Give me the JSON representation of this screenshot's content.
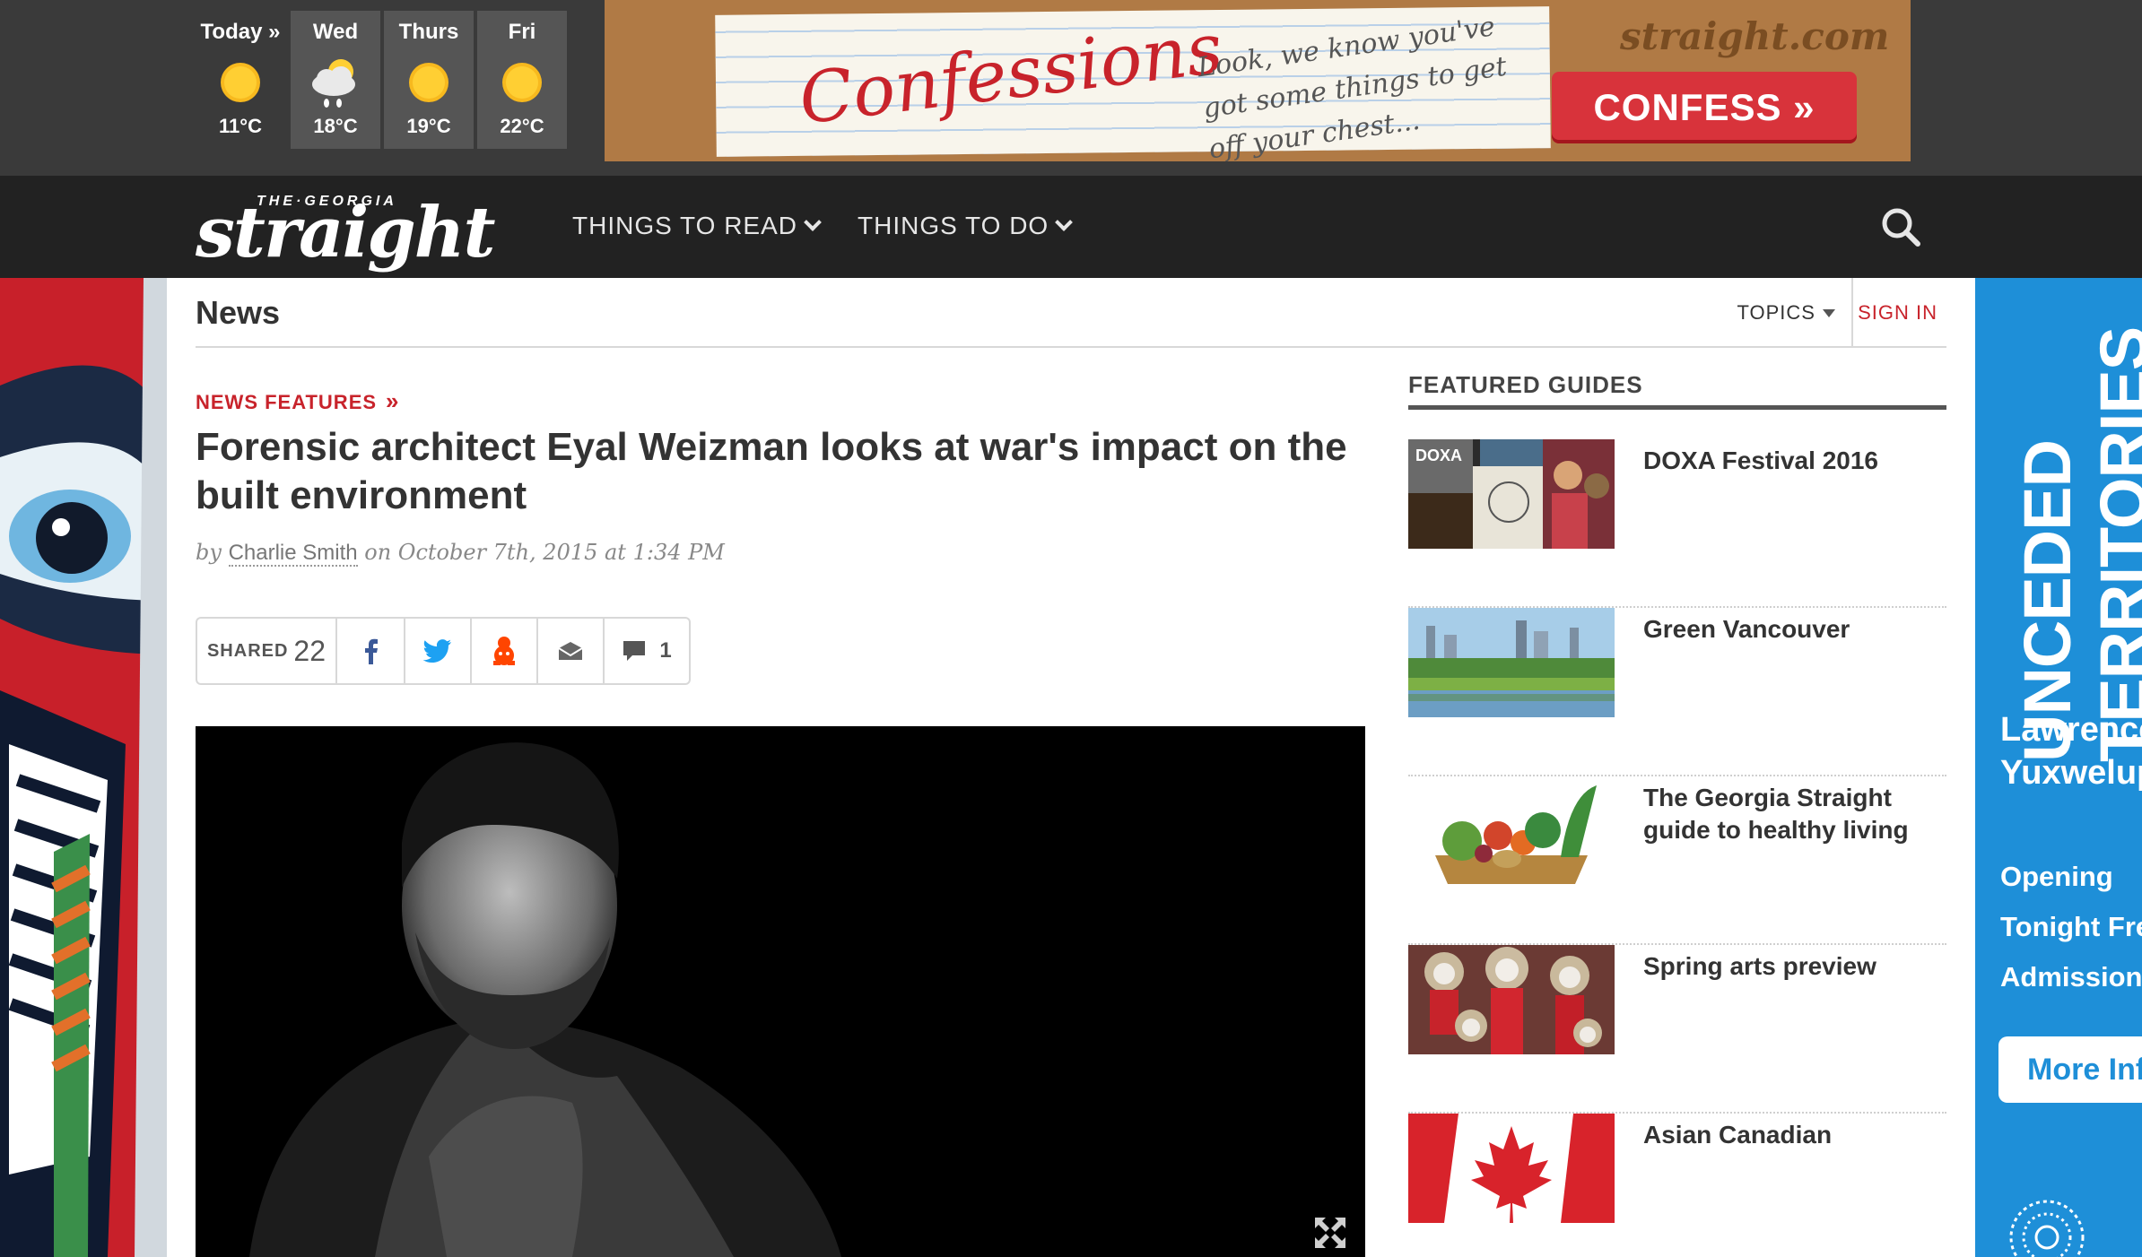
{
  "weather": {
    "days": [
      {
        "name": "Today »",
        "temp": "11°C",
        "icon": "sun-icon"
      },
      {
        "name": "Wed",
        "temp": "18°C",
        "icon": "rain-cloud-icon"
      },
      {
        "name": "Thurs",
        "temp": "19°C",
        "icon": "sun-icon"
      },
      {
        "name": "Fri",
        "temp": "22°C",
        "icon": "sun-icon"
      }
    ]
  },
  "ad_banner": {
    "title": "Confessions",
    "tagline": "Look, we know you've got some things to get off your chest...",
    "brand": "straight.com",
    "cta": "CONFESS »"
  },
  "nav": {
    "logo_small": "THE·GEORGIA",
    "logo": "straight",
    "items": [
      {
        "label": "THINGS TO READ"
      },
      {
        "label": "THINGS TO DO"
      }
    ],
    "search_icon": "search-icon"
  },
  "section": {
    "title": "News",
    "topics": "TOPICS",
    "signin": "SIGN IN"
  },
  "article": {
    "kicker": "NEWS FEATURES",
    "kicker_arrow": "»",
    "headline": "Forensic architect Eyal Weizman looks at war's impact on the built environment",
    "by": "by",
    "author": "Charlie Smith",
    "date": "on October 7th, 2015 at 1:34 PM",
    "share": {
      "label": "SHARED",
      "count": "22",
      "comments": "1"
    }
  },
  "sidebar": {
    "title": "FEATURED GUIDES",
    "guides": [
      {
        "label": "DOXA Festival 2016",
        "thumb_text": "DOXA"
      },
      {
        "label": "Green Vancouver"
      },
      {
        "label": "The Georgia Straight guide to healthy living"
      },
      {
        "label": "Spring arts preview"
      },
      {
        "label": "Asian Canadian"
      }
    ]
  },
  "right_ad": {
    "headline": "UNCEDED TERRITORIES",
    "name": "Lawrence Yuxweluptun",
    "sub": "Opening Tonight Free Admission",
    "button": "More Info"
  },
  "colors": {
    "accent_red": "#c8232b",
    "nav_bg": "#222222",
    "top_bg": "#3a3a3a",
    "right_ad_blue": "#1e8fd8"
  }
}
